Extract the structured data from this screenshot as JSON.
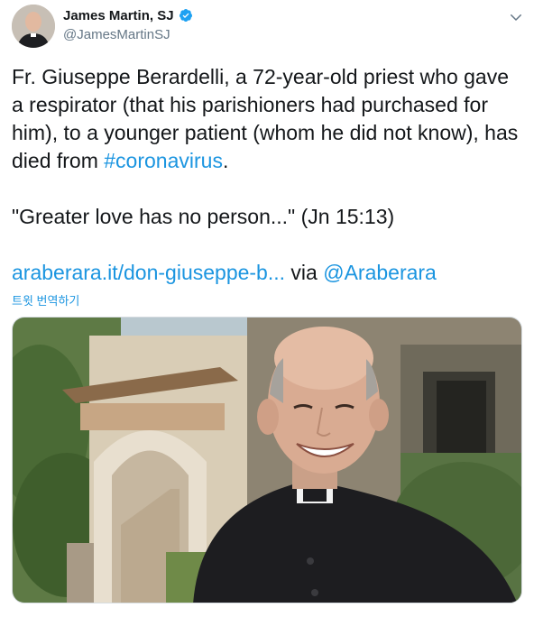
{
  "author": {
    "name": "James Martin, SJ",
    "handle": "@JamesMartinSJ",
    "verified_icon": "verified-badge-icon",
    "avatar_icon": "user-avatar"
  },
  "menu_icon": "chevron-down-icon",
  "tweet": {
    "text_part1": "Fr. Giuseppe Berardelli, a 72-year-old priest who gave a respirator (that his parishioners had purchased for him), to a younger patient (whom he did not know), has died from ",
    "hashtag": "#coronavirus",
    "text_part2": ".",
    "quote": "\"Greater love has no person...\" (Jn 15:13)",
    "url": "araberara.it/don-giuseppe-b...",
    "via": " via ",
    "mention": "@Araberara"
  },
  "translate_label": "트윗 번역하기",
  "colors": {
    "link": "#1b95e0",
    "secondary": "#657786",
    "verified": "#1da1f2"
  }
}
